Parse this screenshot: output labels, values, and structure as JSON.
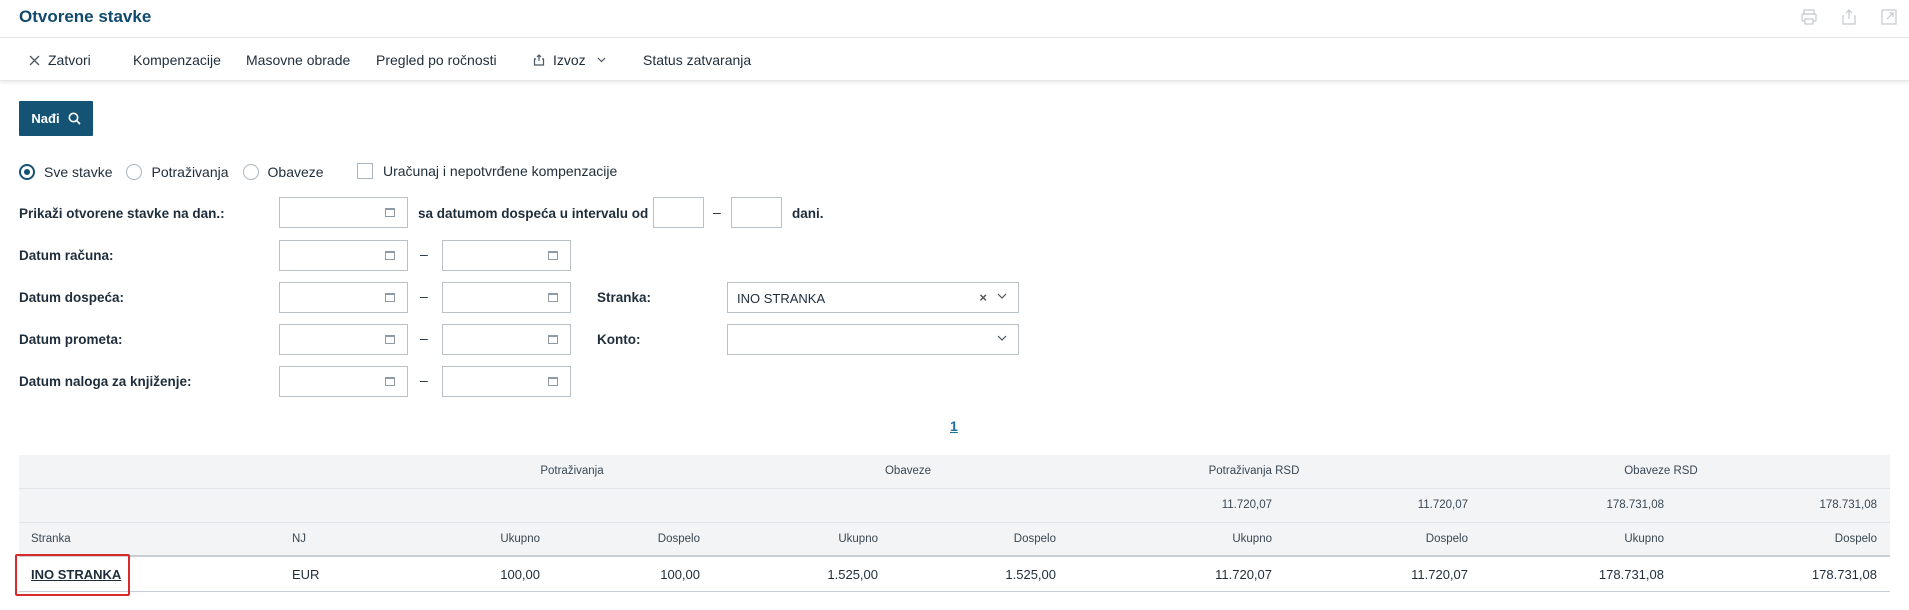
{
  "page": {
    "title": "Otvorene stavke"
  },
  "top_icons": [
    "print-icon",
    "export-icon",
    "open-external-icon"
  ],
  "toolbar": {
    "close_label": "Zatvori",
    "compensation_label": "Kompenzacije",
    "mass_processing_label": "Masovne obrade",
    "maturity_overview_label": "Pregled po ročnosti",
    "export_label": "Izvoz",
    "closing_status_label": "Status zatvaranja"
  },
  "search": {
    "find_label": "Nađi"
  },
  "filters": {
    "radio_all": "Sve stavke",
    "radio_receivables": "Potraživanja",
    "radio_liabilities": "Obaveze",
    "selected_radio": "Sve stavke",
    "unconfirmed_comp_label": "Uračunaj i nepotvrđene kompenzacije",
    "unconfirmed_comp_checked": false,
    "show_open_label": "Prikaži otvorene stavke na dan.:",
    "due_interval_label": "sa datumom dospeća u intervalu od",
    "days_label": "dani.",
    "invoice_date_label": "Datum računa:",
    "due_date_label": "Datum dospeća:",
    "turnover_date_label": "Datum prometa:",
    "posting_date_label": "Datum naloga za knjiženje:",
    "dash": "–",
    "party_label": "Stranka:",
    "party_value": "INO STRANKA",
    "account_label": "Konto:",
    "account_value": ""
  },
  "pagination": {
    "current_page": "1"
  },
  "table": {
    "groups": {
      "receivables": "Potraživanja",
      "liabilities": "Obaveze",
      "receivables_rsd": "Potraživanja RSD",
      "liabilities_rsd": "Obaveze RSD"
    },
    "totals": {
      "receivables_rsd_total": "11.720,07",
      "receivables_rsd_due": "11.720,07",
      "liabilities_rsd_total": "178.731,08",
      "liabilities_rsd_due": "178.731,08"
    },
    "headers": {
      "party": "Stranka",
      "currency": "NJ",
      "rec_total": "Ukupno",
      "rec_due": "Dospelo",
      "liab_total": "Ukupno",
      "liab_due": "Dospelo",
      "rec_rsd_total": "Ukupno",
      "rec_rsd_due": "Dospelo",
      "liab_rsd_total": "Ukupno",
      "liab_rsd_due": "Dospelo"
    },
    "rows": [
      {
        "party": "INO STRANKA",
        "currency": "EUR",
        "rec_total": "100,00",
        "rec_due": "100,00",
        "liab_total": "1.525,00",
        "liab_due": "1.525,00",
        "rec_rsd_total": "11.720,07",
        "rec_rsd_due": "11.720,07",
        "liab_rsd_total": "178.731,08",
        "liab_rsd_due": "178.731,08"
      }
    ]
  },
  "colors": {
    "primary": "#155375",
    "title": "#114a6d",
    "link": "#1a6fa3",
    "highlight": "#d92b2b"
  }
}
